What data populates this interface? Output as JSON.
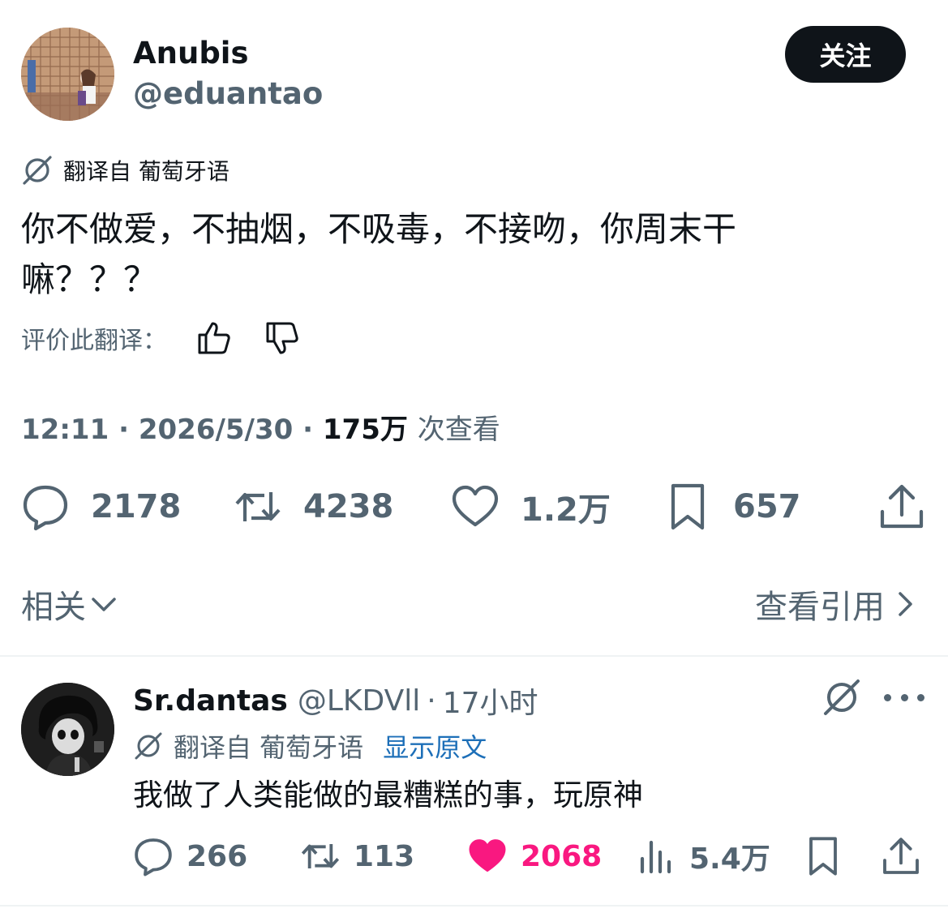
{
  "main_tweet": {
    "display_name": "Anubis",
    "handle": "@eduantao",
    "follow_label": "关注",
    "translated_from": "翻译自 葡萄牙语",
    "text_line1": "你不做爱，不抽烟，不吸毒，不接吻，你周末干",
    "text_line2": "嘛？？？",
    "rate_label": "评价此翻译：",
    "time": "12:11",
    "date": "2026/5/30",
    "dot": "·",
    "views_count": "175万",
    "views_label": "次查看",
    "replies": "2178",
    "retweets": "4238",
    "likes": "1.2万",
    "bookmarks": "657",
    "related_label": "相关",
    "view_quotes_label": "查看引用"
  },
  "reply": {
    "display_name": "Sr.dantas",
    "handle": "@LKDVll",
    "dot": "·",
    "time": "17小时",
    "translated_from": "翻译自 葡萄牙语",
    "show_original": "显示原文",
    "text": "我做了人类能做的最糟糕的事，玩原神",
    "replies": "266",
    "retweets": "113",
    "likes": "2068",
    "views": "5.4万"
  },
  "colors": {
    "text_primary": "#0f1419",
    "text_secondary": "#536471",
    "like_active": "#f91880",
    "link": "#1d6fb8",
    "divider": "#eff3f4"
  },
  "icons": [
    "globe-slash-icon",
    "thumbs-up-icon",
    "thumbs-down-icon",
    "reply-icon",
    "retweet-icon",
    "heart-icon",
    "bookmark-icon",
    "share-icon",
    "chevron-down-icon",
    "chevron-right-icon",
    "more-icon",
    "views-icon"
  ]
}
